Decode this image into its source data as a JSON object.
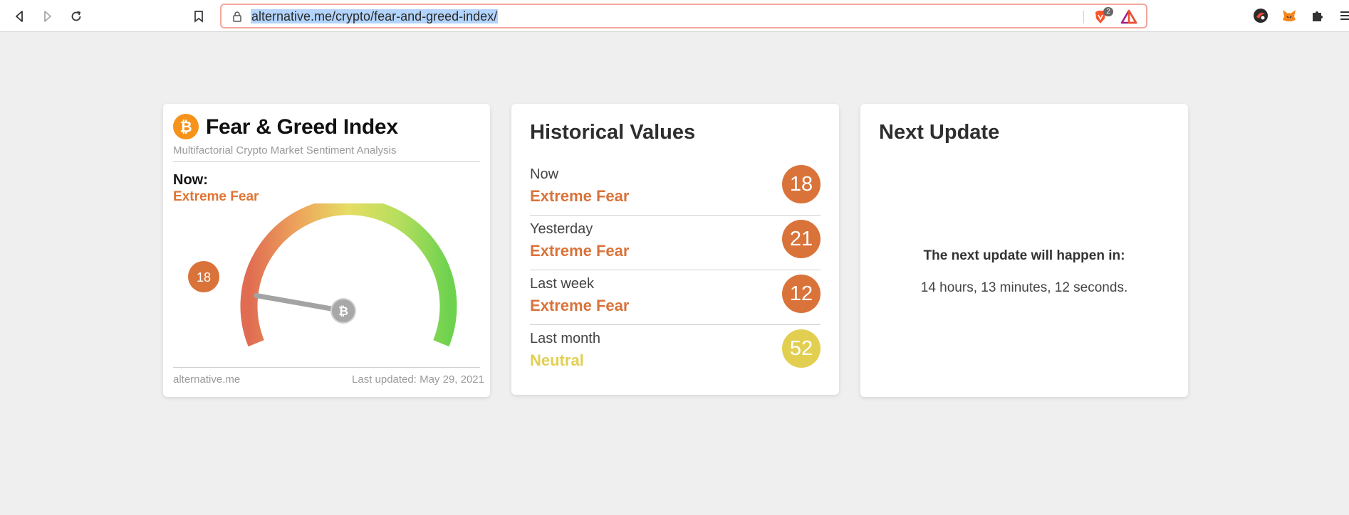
{
  "browser": {
    "url_prefix": "alternative.me/crypto/fear-and-greed-index/",
    "brave_badge_count": "2",
    "icons": [
      "back-icon",
      "forward-icon",
      "reload-icon",
      "bookmark-icon",
      "lock-icon",
      "brave-shield-icon",
      "brave-rewards-icon",
      "extension-icon",
      "metamask-icon",
      "puzzle-icon",
      "menu-icon"
    ]
  },
  "fear_greed": {
    "title": "Fear & Greed Index",
    "subtitle": "Multifactorial Crypto Market Sentiment Analysis",
    "now_label": "Now:",
    "now_value": "Extreme Fear",
    "gauge_value": "18",
    "gauge_level": 18,
    "gauge_range": [
      0,
      100
    ],
    "footer_source": "alternative.me",
    "footer_updated": "Last updated: May 29, 2021",
    "accent_color": "#e07435"
  },
  "historical": {
    "title": "Historical Values",
    "rows": [
      {
        "label": "Now",
        "status": "Extreme Fear",
        "value": "18",
        "color": "#d9733a"
      },
      {
        "label": "Yesterday",
        "status": "Extreme Fear",
        "value": "21",
        "color": "#d9733a"
      },
      {
        "label": "Last week",
        "status": "Extreme Fear",
        "value": "12",
        "color": "#d9733a"
      },
      {
        "label": "Last month",
        "status": "Neutral",
        "value": "52",
        "color": "#e2cf52"
      }
    ]
  },
  "next_update": {
    "title": "Next Update",
    "label": "The next update will happen in:",
    "countdown": "14 hours, 13 minutes, 12 seconds."
  }
}
